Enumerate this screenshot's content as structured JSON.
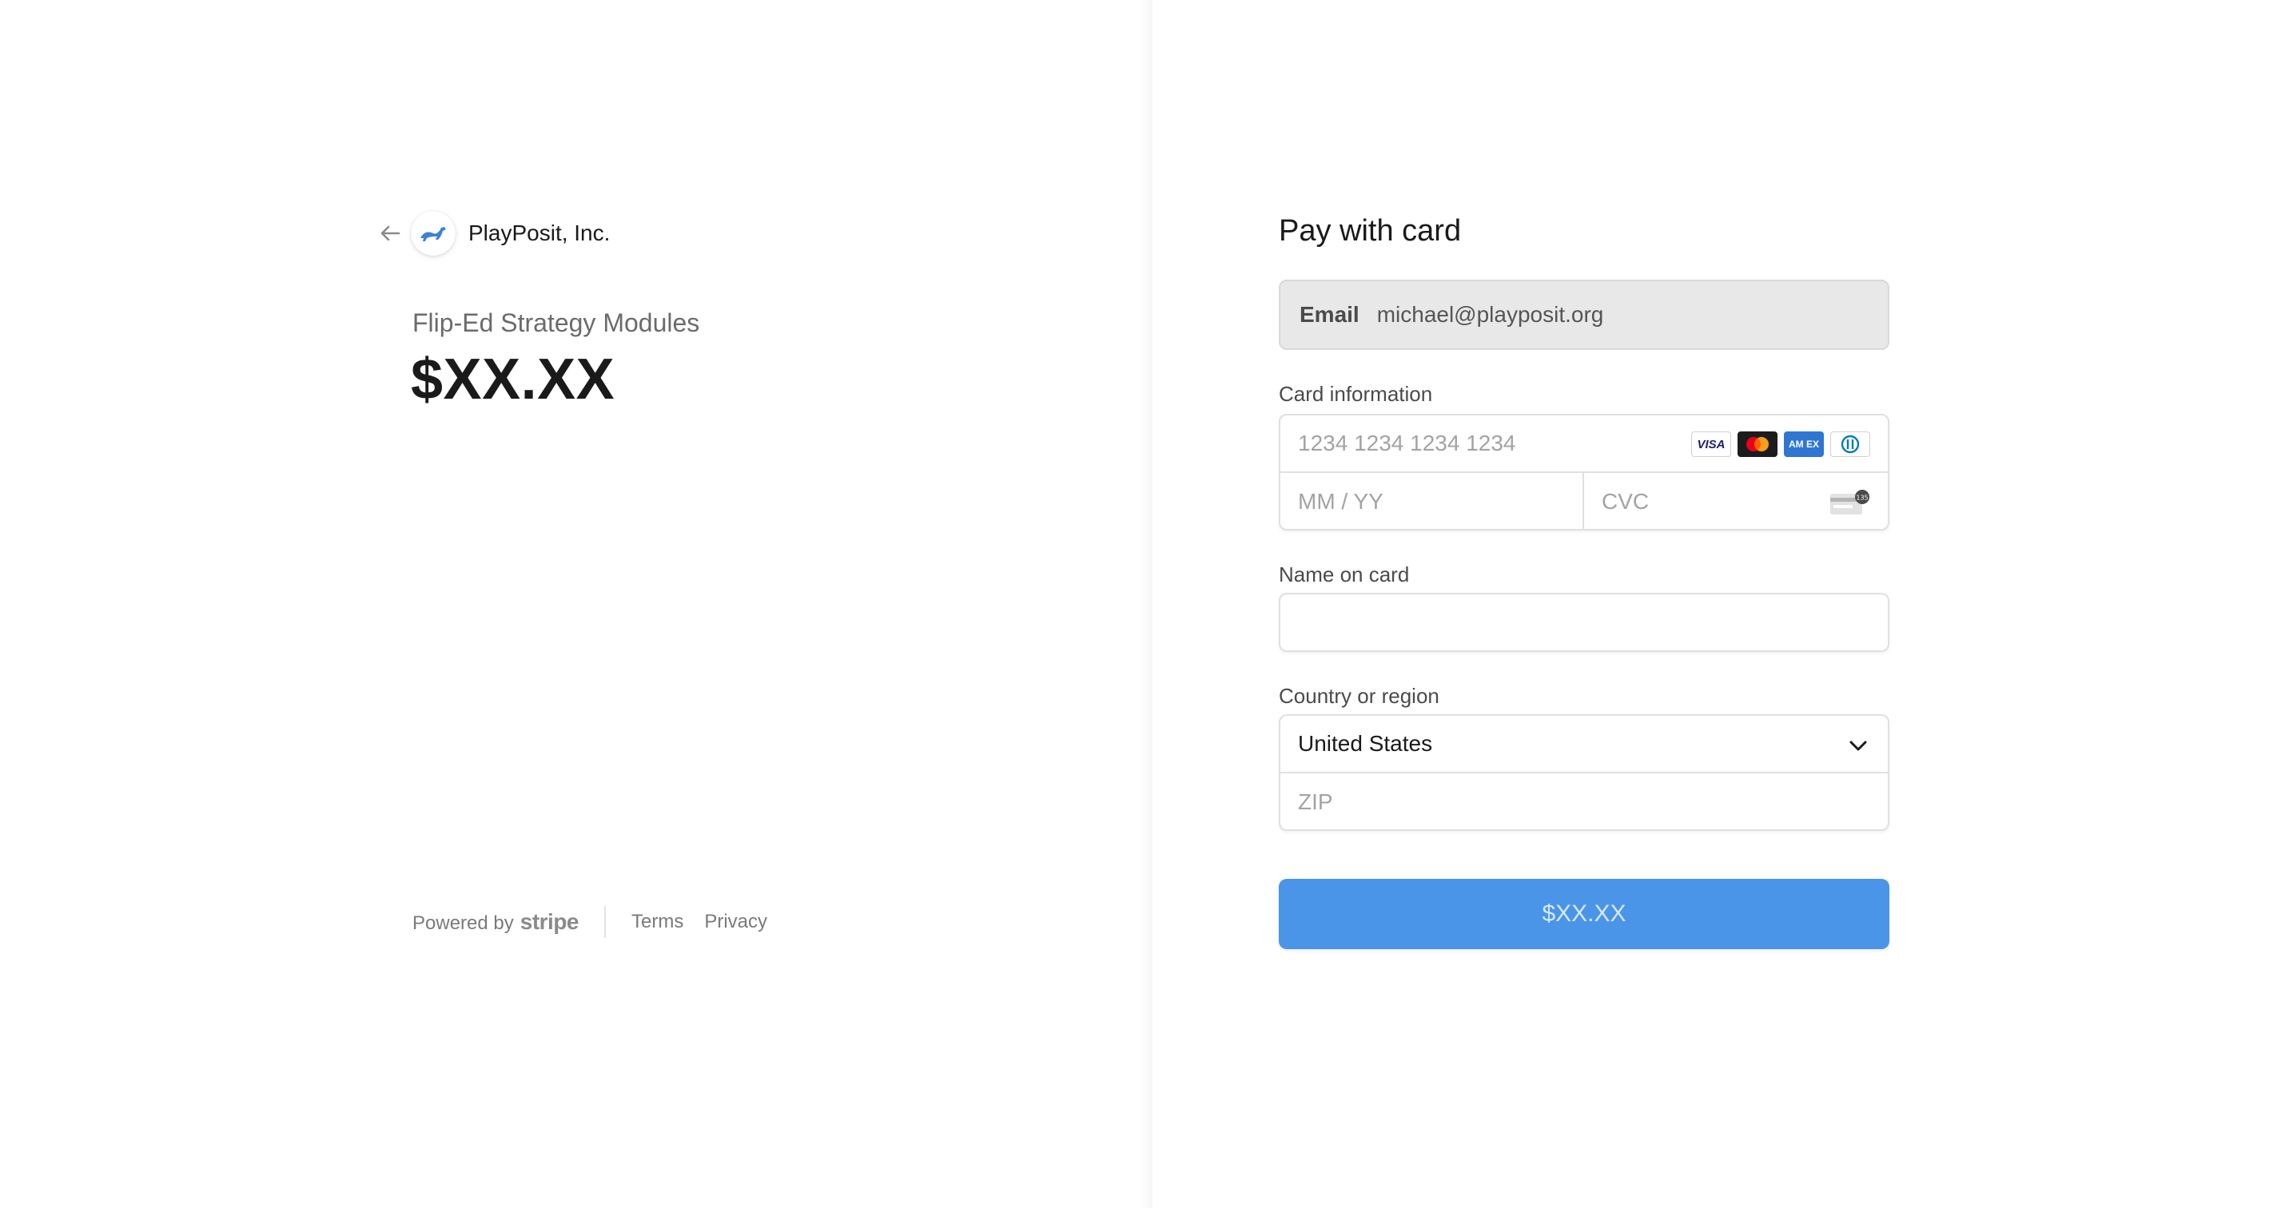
{
  "merchant": {
    "name": "PlayPosit, Inc.",
    "logo_icon": "playposit-logo-icon",
    "back_icon": "arrow-left-icon"
  },
  "product": {
    "name": "Flip-Ed Strategy Modules",
    "price": "$XX.XX"
  },
  "footer": {
    "powered_by": "Powered by",
    "brand": "stripe",
    "terms": "Terms",
    "privacy": "Privacy"
  },
  "payment": {
    "title": "Pay with card",
    "email_label": "Email",
    "email_value": "michael@playposit.org",
    "card_label": "Card information",
    "card_number_placeholder": "1234 1234 1234 1234",
    "expiry_placeholder": "MM / YY",
    "cvc_placeholder": "CVC",
    "card_brands": [
      "visa-icon",
      "mastercard-icon",
      "amex-icon",
      "diners-icon"
    ],
    "brand_visa": "VISA",
    "brand_amex": "AM EX",
    "name_label": "Name on card",
    "name_value": "",
    "country_label": "Country or region",
    "country_value": "United States",
    "zip_placeholder": "ZIP",
    "pay_button_label": "$XX.XX"
  },
  "colors": {
    "accent": "#4a95e8",
    "logo_blue": "#3b82d6"
  }
}
